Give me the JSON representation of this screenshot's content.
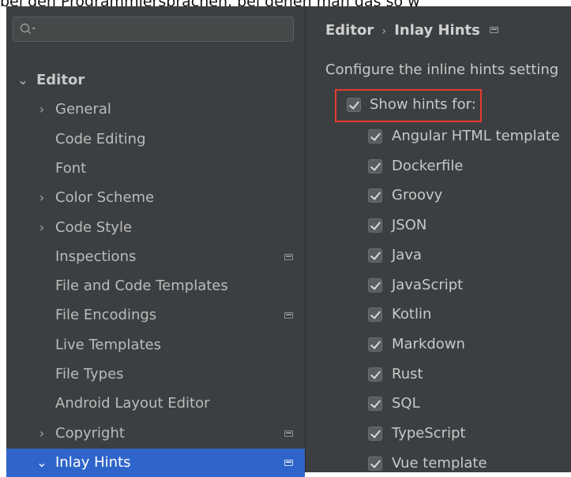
{
  "caption": "bei den Programmiersprachen, bei denen man das so w",
  "search": {
    "placeholder": "Q▾"
  },
  "sidebar": {
    "items": [
      {
        "label": "Editor",
        "chevron": "⌄",
        "level": 0,
        "bold": true,
        "icon": ""
      },
      {
        "label": "General",
        "chevron": "›",
        "level": 1,
        "icon": ""
      },
      {
        "label": "Code Editing",
        "chevron": "",
        "level": 1,
        "icon": ""
      },
      {
        "label": "Font",
        "chevron": "",
        "level": 1,
        "icon": ""
      },
      {
        "label": "Color Scheme",
        "chevron": "›",
        "level": 1,
        "icon": ""
      },
      {
        "label": "Code Style",
        "chevron": "›",
        "level": 1,
        "icon": ""
      },
      {
        "label": "Inspections",
        "chevron": "",
        "level": 1,
        "icon": "project-icon"
      },
      {
        "label": "File and Code Templates",
        "chevron": "",
        "level": 1,
        "icon": ""
      },
      {
        "label": "File Encodings",
        "chevron": "",
        "level": 1,
        "icon": "project-icon"
      },
      {
        "label": "Live Templates",
        "chevron": "",
        "level": 1,
        "icon": ""
      },
      {
        "label": "File Types",
        "chevron": "",
        "level": 1,
        "icon": ""
      },
      {
        "label": "Android Layout Editor",
        "chevron": "",
        "level": 1,
        "icon": ""
      },
      {
        "label": "Copyright",
        "chevron": "›",
        "level": 1,
        "icon": "project-icon"
      },
      {
        "label": "Inlay Hints",
        "chevron": "⌄",
        "level": 1,
        "selected": true,
        "icon": "project-icon"
      }
    ]
  },
  "content": {
    "breadcrumb": {
      "parent": "Editor",
      "separator": "›",
      "current": "Inlay Hints"
    },
    "description": "Configure the inline hints setting",
    "show_hints": {
      "label": "Show hints for:",
      "checked": true
    },
    "languages": [
      {
        "label": "Angular HTML template",
        "checked": true
      },
      {
        "label": "Dockerfile",
        "checked": true
      },
      {
        "label": "Groovy",
        "checked": true
      },
      {
        "label": "JSON",
        "checked": true
      },
      {
        "label": "Java",
        "checked": true
      },
      {
        "label": "JavaScript",
        "checked": true
      },
      {
        "label": "Kotlin",
        "checked": true
      },
      {
        "label": "Markdown",
        "checked": true
      },
      {
        "label": "Rust",
        "checked": true
      },
      {
        "label": "SQL",
        "checked": true
      },
      {
        "label": "TypeScript",
        "checked": true
      },
      {
        "label": "Vue template",
        "checked": true
      }
    ]
  },
  "colors": {
    "panel_bg": "#3c3f41",
    "selection": "#2f65ca",
    "highlight_box": "#e63b2e"
  }
}
